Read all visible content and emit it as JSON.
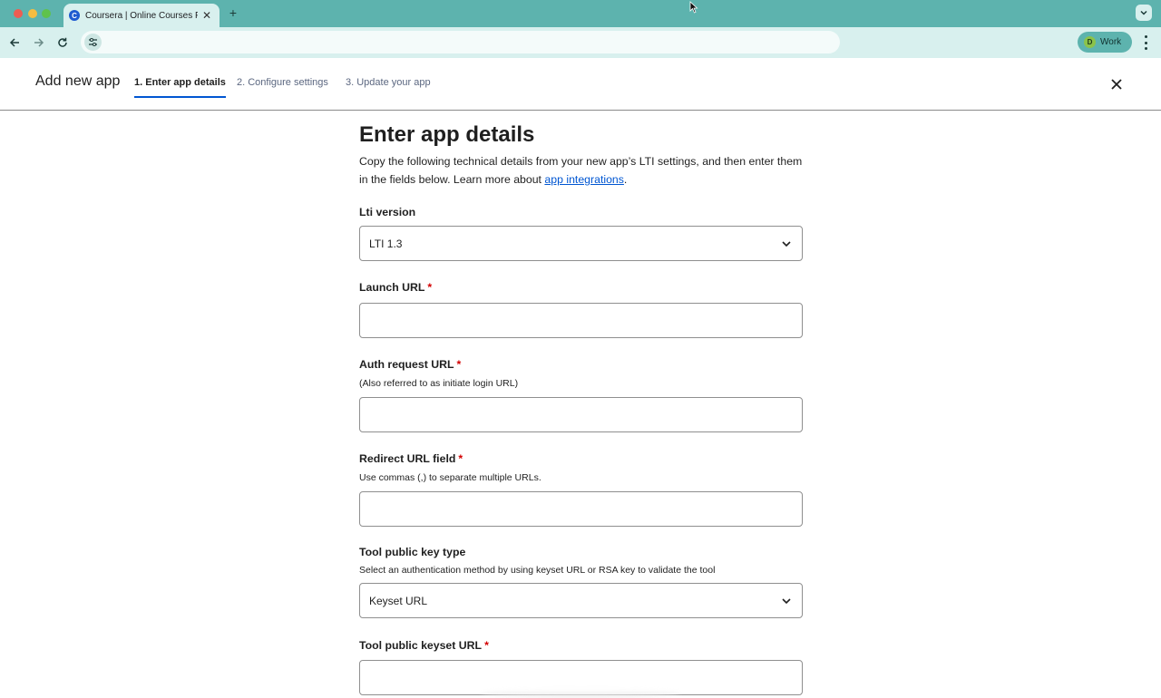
{
  "browser": {
    "tab_title": "Coursera | Online Courses Fro",
    "tab_favicon_letter": "C",
    "profile_initial": "D",
    "profile_label": "Work",
    "address": "",
    "colors": {
      "tabbar": "#5db3ae",
      "toolbar": "#d8f0ee"
    }
  },
  "header": {
    "title": "Add new app",
    "steps": [
      {
        "label": "1. Enter app details",
        "active": true
      },
      {
        "label": "2. Configure settings",
        "active": false
      },
      {
        "label": "3. Update your app",
        "active": false
      }
    ]
  },
  "form": {
    "title": "Enter app details",
    "intro_text": "Copy the following technical details from your new app’s LTI settings, and then enter them in the fields below. Learn more about ",
    "intro_link": "app integrations",
    "intro_end": ".",
    "lti_version": {
      "label": "Lti version",
      "value": "LTI 1.3"
    },
    "launch_url": {
      "label": "Launch URL",
      "required_mark": "*",
      "value": ""
    },
    "auth_request_url": {
      "label": "Auth request URL",
      "required_mark": "*",
      "helper": "(Also referred to as initiate login URL)",
      "value": ""
    },
    "redirect_url": {
      "label": "Redirect URL field",
      "required_mark": "*",
      "helper": "Use commas (,) to separate multiple URLs.",
      "value": ""
    },
    "tool_public_key_type": {
      "label": "Tool public key type",
      "helper": "Select an authentication method by using keyset URL or RSA key to validate the tool",
      "value": "Keyset URL"
    },
    "tool_public_keyset_url": {
      "label": "Tool public keyset URL",
      "required_mark": "*",
      "value": ""
    }
  },
  "colors": {
    "accent": "#0056d2",
    "required": "#d30001"
  }
}
